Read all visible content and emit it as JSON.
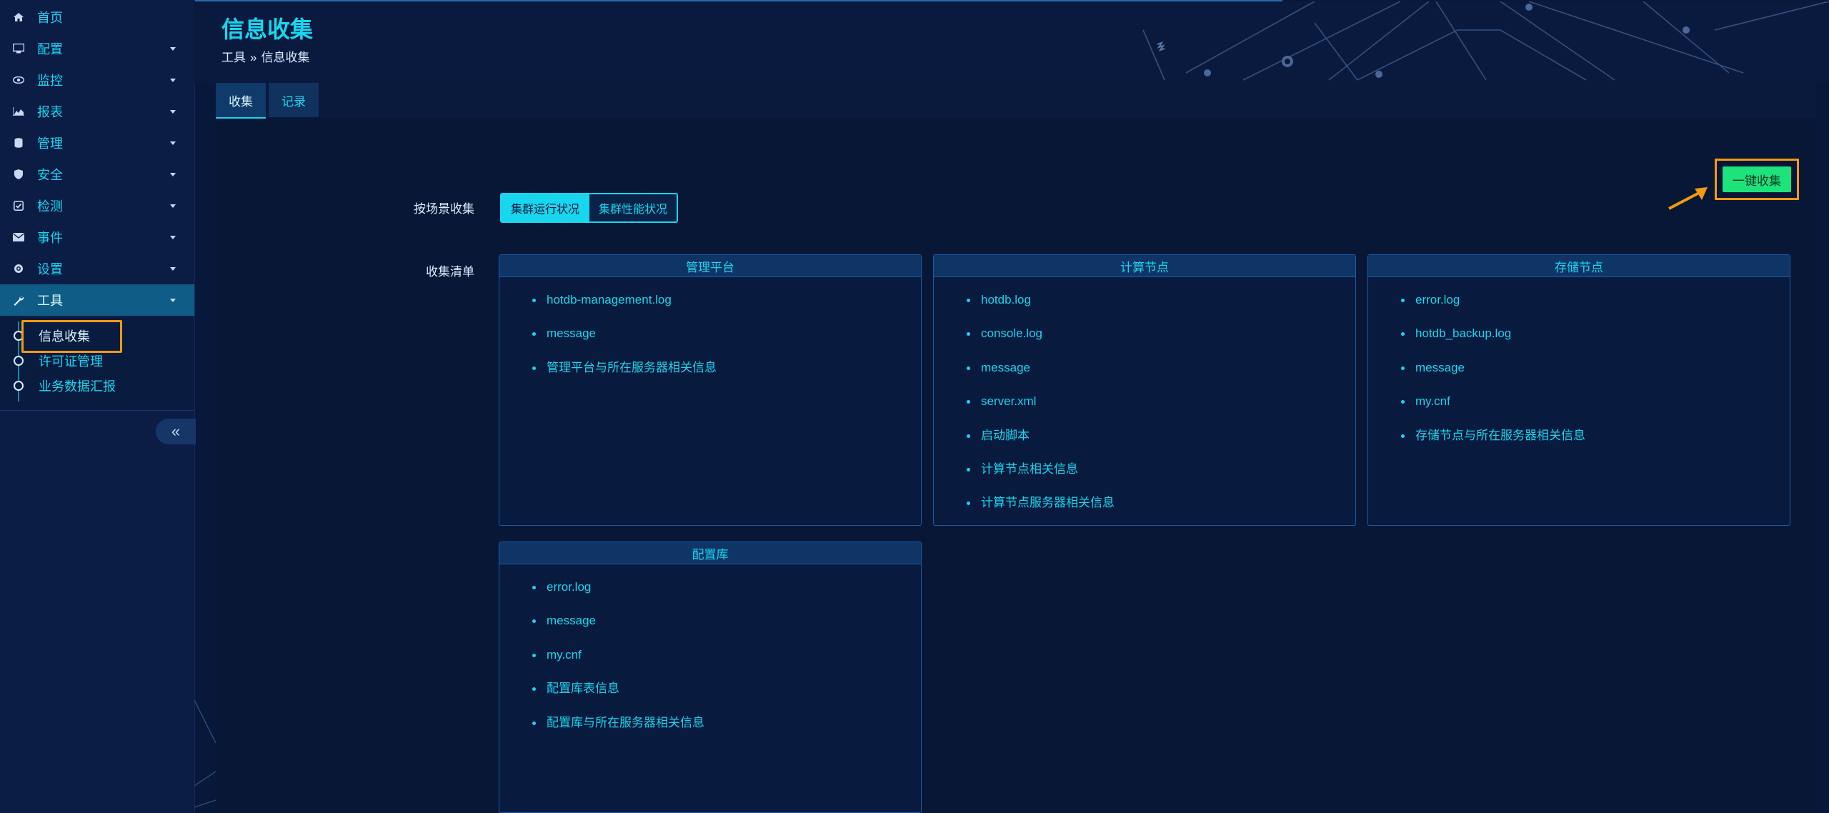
{
  "sidebar": {
    "items": [
      {
        "label": "首页",
        "icon": "home-icon",
        "has_caret": false
      },
      {
        "label": "配置",
        "icon": "monitor-icon",
        "has_caret": true
      },
      {
        "label": "监控",
        "icon": "eye-icon",
        "has_caret": true
      },
      {
        "label": "报表",
        "icon": "area-chart-icon",
        "has_caret": true
      },
      {
        "label": "管理",
        "icon": "database-icon",
        "has_caret": true
      },
      {
        "label": "安全",
        "icon": "shield-icon",
        "has_caret": true
      },
      {
        "label": "检测",
        "icon": "check-square-icon",
        "has_caret": true
      },
      {
        "label": "事件",
        "icon": "envelope-icon",
        "has_caret": true
      },
      {
        "label": "设置",
        "icon": "gear-icon",
        "has_caret": true
      },
      {
        "label": "工具",
        "icon": "wrench-icon",
        "has_caret": true
      }
    ],
    "subitems": [
      {
        "label": "信息收集"
      },
      {
        "label": "许可证管理"
      },
      {
        "label": "业务数据汇报"
      }
    ],
    "collapse_glyph": "«"
  },
  "header": {
    "title": "信息收集",
    "breadcrumb": {
      "parent": "工具",
      "sep": "»",
      "current": "信息收集"
    }
  },
  "tabs": [
    {
      "label": "收集"
    },
    {
      "label": "记录"
    }
  ],
  "form": {
    "scene_label": "按场景收集",
    "list_label": "收集清单",
    "scene_options": [
      {
        "label": "集群运行状况",
        "selected": true
      },
      {
        "label": "集群性能状况",
        "selected": false
      }
    ],
    "one_click_label": "一键收集"
  },
  "cards": [
    {
      "title": "管理平台",
      "items": [
        "hotdb-management.log",
        "message",
        "管理平台与所在服务器相关信息"
      ]
    },
    {
      "title": "计算节点",
      "items": [
        "hotdb.log",
        "console.log",
        "message",
        "server.xml",
        "启动脚本",
        "计算节点相关信息",
        "计算节点服务器相关信息"
      ]
    },
    {
      "title": "存储节点",
      "items": [
        "error.log",
        "hotdb_backup.log",
        "message",
        "my.cnf",
        "存储节点与所在服务器相关信息"
      ]
    },
    {
      "title": "配置库",
      "items": [
        "error.log",
        "message",
        "my.cnf",
        "配置库表信息",
        "配置库与所在服务器相关信息"
      ]
    }
  ],
  "colors": {
    "accent": "#19d6ef",
    "primary_button": "#1ee37a",
    "highlight": "#f29a12",
    "background": "#08183a"
  }
}
